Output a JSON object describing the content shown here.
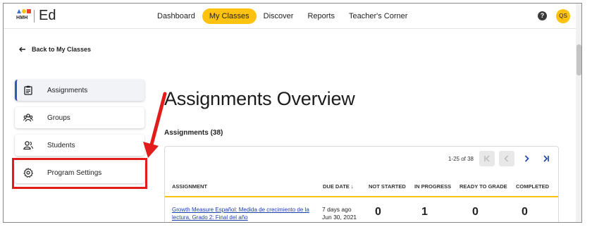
{
  "topbar": {
    "logo_text": "HMH",
    "brand": "Ed",
    "nav": [
      {
        "label": "Dashboard",
        "active": false
      },
      {
        "label": "My Classes",
        "active": true
      },
      {
        "label": "Discover",
        "active": false
      },
      {
        "label": "Reports",
        "active": false
      },
      {
        "label": "Teacher's Corner",
        "active": false
      }
    ],
    "help_glyph": "?",
    "avatar_initials": "QS"
  },
  "back_link": "Back to My Classes",
  "sidebar": {
    "items": [
      {
        "label": "Assignments",
        "icon": "clipboard-icon",
        "active": true
      },
      {
        "label": "Groups",
        "icon": "groups-icon",
        "active": false
      },
      {
        "label": "Students",
        "icon": "students-icon",
        "active": false
      },
      {
        "label": "Program Settings",
        "icon": "gear-icon",
        "active": false
      }
    ]
  },
  "main": {
    "title": "Assignments Overview",
    "subtitle": "Assignments (38)",
    "pager": {
      "range": "1-25 of 38"
    },
    "table": {
      "headers": [
        "ASSIGNMENT",
        "DUE DATE ↓",
        "NOT STARTED",
        "IN PROGRESS",
        "READY TO GRADE",
        "COMPLETED"
      ],
      "rows": [
        {
          "assignment": "Growth Measure Español: Medida de crecimiento de la lectura, Grado 2: Final del año",
          "due_relative": "7 days ago",
          "due_date": "Jun 30, 2021",
          "not_started": "0",
          "in_progress": "1",
          "ready_to_grade": "0",
          "completed": "0"
        }
      ]
    }
  },
  "colors": {
    "accent": "#ffc20e",
    "highlight": "#e21b1b",
    "link": "#1a3fb2",
    "active_border": "#2f5bb8"
  }
}
